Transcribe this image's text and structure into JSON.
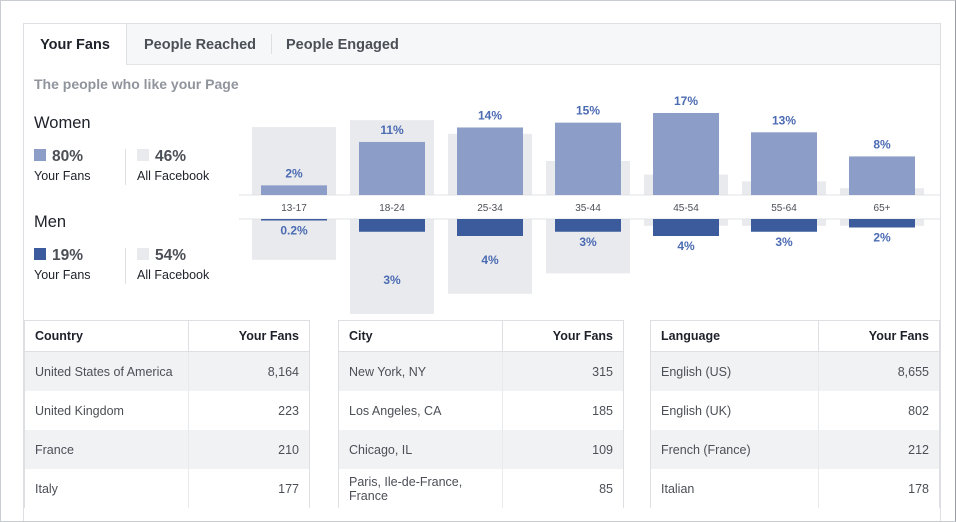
{
  "tabs": [
    {
      "label": "Your Fans",
      "active": true
    },
    {
      "label": "People Reached",
      "active": false
    },
    {
      "label": "People Engaged",
      "active": false
    }
  ],
  "subtitle": "The people who like your Page",
  "women": {
    "title": "Women",
    "fans_pct": "80%",
    "fans_label": "Your Fans",
    "all_pct": "46%",
    "all_label": "All Facebook"
  },
  "men": {
    "title": "Men",
    "fans_pct": "19%",
    "fans_label": "Your Fans",
    "all_pct": "54%",
    "all_label": "All Facebook"
  },
  "colors": {
    "women_fans": "#8c9dc8",
    "men_fans": "#3b5b9c",
    "all_facebook": "#e9eaed",
    "label_blue": "#4b6bb3"
  },
  "chart_data": {
    "type": "bar",
    "categories": [
      "13-17",
      "18-24",
      "25-34",
      "35-44",
      "45-54",
      "55-64",
      "65+"
    ],
    "series": [
      {
        "name": "Women · Your Fans",
        "values": [
          2,
          11,
          14,
          15,
          17,
          13,
          8
        ]
      },
      {
        "name": "Men · Your Fans",
        "values": [
          0.2,
          3,
          4,
          3,
          4,
          3,
          2
        ]
      }
    ],
    "women_labels": [
      "2%",
      "11%",
      "14%",
      "15%",
      "17%",
      "13%",
      "8%"
    ],
    "men_labels": [
      "0.2%",
      "3%",
      "4%",
      "3%",
      "4%",
      "3%",
      "2%"
    ],
    "all_facebook_women": [
      10,
      11,
      9,
      5,
      3,
      2,
      1
    ],
    "all_facebook_men": [
      6,
      14,
      11,
      8,
      1,
      1,
      1
    ]
  },
  "tables": [
    {
      "col1": "Country",
      "col2": "Your Fans",
      "rows": [
        [
          "United States of America",
          "8,164"
        ],
        [
          "United Kingdom",
          "223"
        ],
        [
          "France",
          "210"
        ],
        [
          "Italy",
          "177"
        ]
      ]
    },
    {
      "col1": "City",
      "col2": "Your Fans",
      "rows": [
        [
          "New York, NY",
          "315"
        ],
        [
          "Los Angeles, CA",
          "185"
        ],
        [
          "Chicago, IL",
          "109"
        ],
        [
          "Paris, Ile-de-France, France",
          "85"
        ]
      ]
    },
    {
      "col1": "Language",
      "col2": "Your Fans",
      "rows": [
        [
          "English (US)",
          "8,655"
        ],
        [
          "English (UK)",
          "802"
        ],
        [
          "French (France)",
          "212"
        ],
        [
          "Italian",
          "178"
        ]
      ]
    }
  ]
}
